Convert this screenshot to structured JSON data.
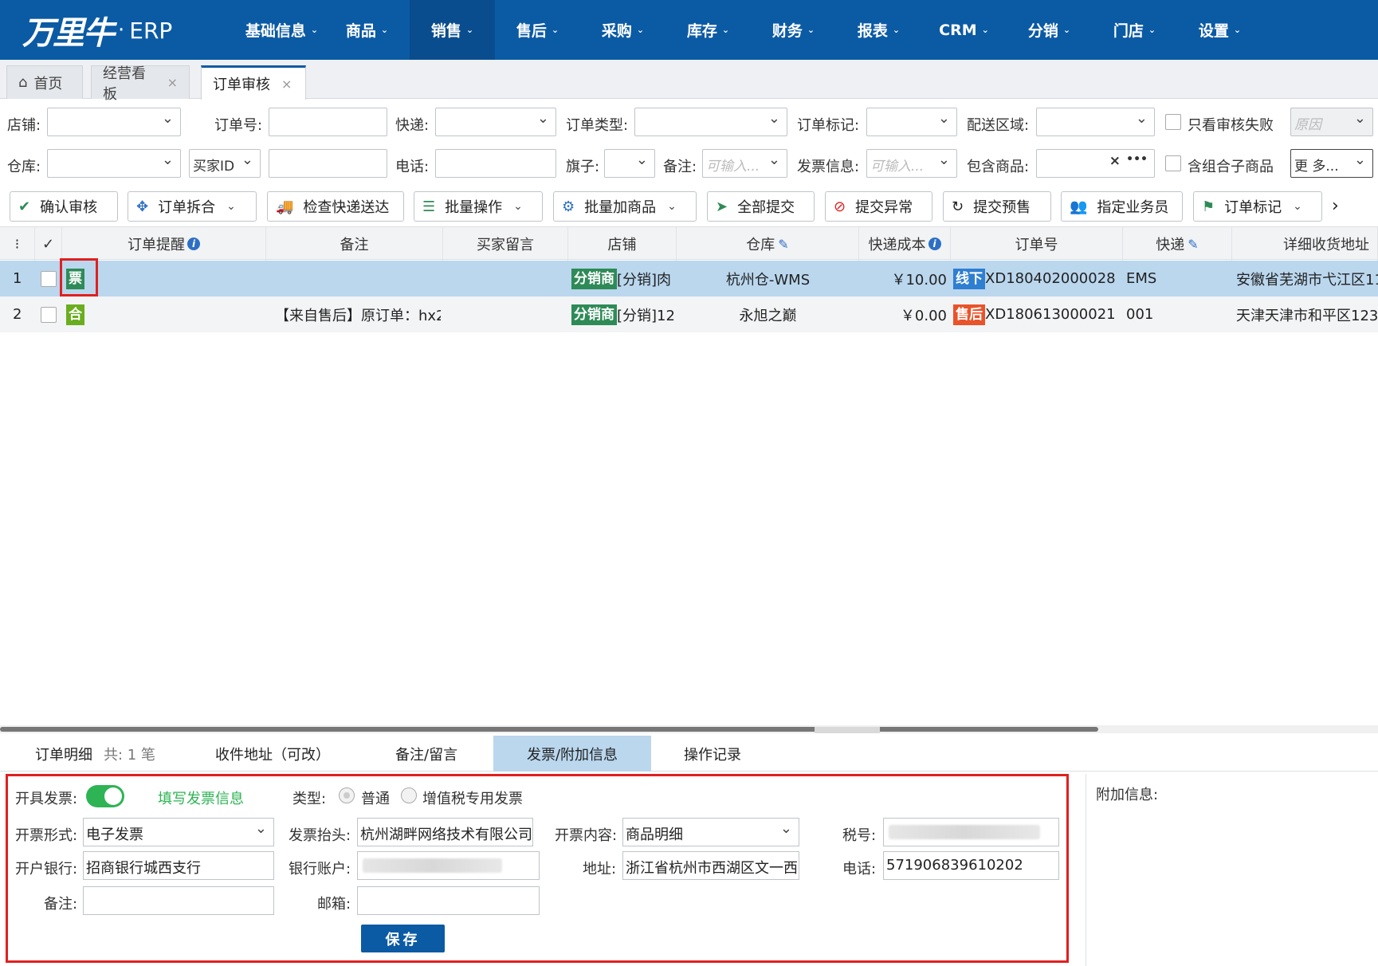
{
  "brand": {
    "logo": "万里牛",
    "dot": "·",
    "suffix": "ERP"
  },
  "nav": [
    {
      "label": "基础信息"
    },
    {
      "label": "商品"
    },
    {
      "label": "销售"
    },
    {
      "label": "售后"
    },
    {
      "label": "采购"
    },
    {
      "label": "库存"
    },
    {
      "label": "财务"
    },
    {
      "label": "报表"
    },
    {
      "label": "CRM"
    },
    {
      "label": "分销"
    },
    {
      "label": "门店"
    },
    {
      "label": "设置"
    }
  ],
  "tabs": [
    {
      "label": "首页"
    },
    {
      "label": "经营看板",
      "close": "×"
    },
    {
      "label": "订单审核",
      "close": "×"
    }
  ],
  "filters": {
    "shop": "店铺:",
    "order_no": "订单号:",
    "express": "快递:",
    "order_type": "订单类型:",
    "order_mark": "订单标记:",
    "region": "配送区域:",
    "only_fail": "只看审核失败",
    "reason_ph": "原因",
    "warehouse": "仓库:",
    "buyer_id": "买家ID",
    "phone": "电话:",
    "flag": "旗子:",
    "remark": "备注:",
    "remark_ph": "可输入...",
    "invoice_info": "发票信息:",
    "invoice_ph": "可输入...",
    "contains_goods": "包含商品:",
    "clear": "×",
    "more_dots": "•••",
    "combo": "含组合子商品",
    "more": "更 多..."
  },
  "toolbar": [
    {
      "label": "确认审核",
      "icon": "✔"
    },
    {
      "label": "订单拆合",
      "icon": "✥"
    },
    {
      "label": "检查快递送达",
      "icon": "🚚"
    },
    {
      "label": "批量操作",
      "icon": "☰"
    },
    {
      "label": "批量加商品",
      "icon": "⚙"
    },
    {
      "label": "全部提交",
      "icon": "➤"
    },
    {
      "label": "提交异常",
      "icon": "⊘"
    },
    {
      "label": "提交预售",
      "icon": "↻"
    },
    {
      "label": "指定业务员",
      "icon": "👥"
    },
    {
      "label": "订单标记",
      "icon": "⚑"
    },
    {
      "label": "›"
    }
  ],
  "grid": {
    "headers": {
      "menu": "⁝",
      "check": "✓",
      "reminder": "订单提醒",
      "remark": "备注",
      "buyer_msg": "买家留言",
      "shop": "店铺",
      "warehouse": "仓库",
      "cost": "快递成本",
      "order_no": "订单号",
      "express": "快递",
      "address": "详细收货地址"
    },
    "rows": [
      {
        "idx": "1",
        "tag": "票",
        "remark": "",
        "shop_badge": "分销商",
        "shop": "[分销]肉",
        "warehouse": "杭州仓-WMS",
        "cost": "￥10.00",
        "order_badge": "线下",
        "order_no": "XD180402000028",
        "express": "EMS",
        "address": "安徽省芜湖市弋江区11"
      },
      {
        "idx": "2",
        "tag": "合",
        "remark": "【来自售后】原订单：hx2(",
        "shop_badge": "分销商",
        "shop": "[分销]12",
        "warehouse": "永旭之巅",
        "cost": "￥0.00",
        "order_badge": "售后",
        "order_no": "XD180613000021",
        "express": "001",
        "address": "天津天津市和平区1232"
      }
    ]
  },
  "bottom_tabs": [
    {
      "label": "订单明细",
      "sub": "共: 1 笔"
    },
    {
      "label": "收件地址（可改）"
    },
    {
      "label": "备注/留言"
    },
    {
      "label": "发票/附加信息"
    },
    {
      "label": "操作记录"
    }
  ],
  "invoice": {
    "issue_label": "开具发票:",
    "fill_link": "填写发票信息",
    "type_label": "类型:",
    "type_normal": "普通",
    "type_vat": "增值税专用发票",
    "form_label": "开票形式:",
    "form_value": "电子发票",
    "title_label": "发票抬头:",
    "title_value": "杭州湖畔网络技术有限公司",
    "content_label": "开票内容:",
    "content_value": "商品明细",
    "tax_label": "税号:",
    "bank_label": "开户银行:",
    "bank_value": "招商银行城西支行",
    "account_label": "银行账户:",
    "addr_label": "地址:",
    "addr_value": "浙江省杭州市西湖区文一西",
    "phone_label": "电话:",
    "phone_value": "571906839610202",
    "remark_label": "备注:",
    "email_label": "邮箱:",
    "save": "保存",
    "extra_label": "附加信息:"
  }
}
